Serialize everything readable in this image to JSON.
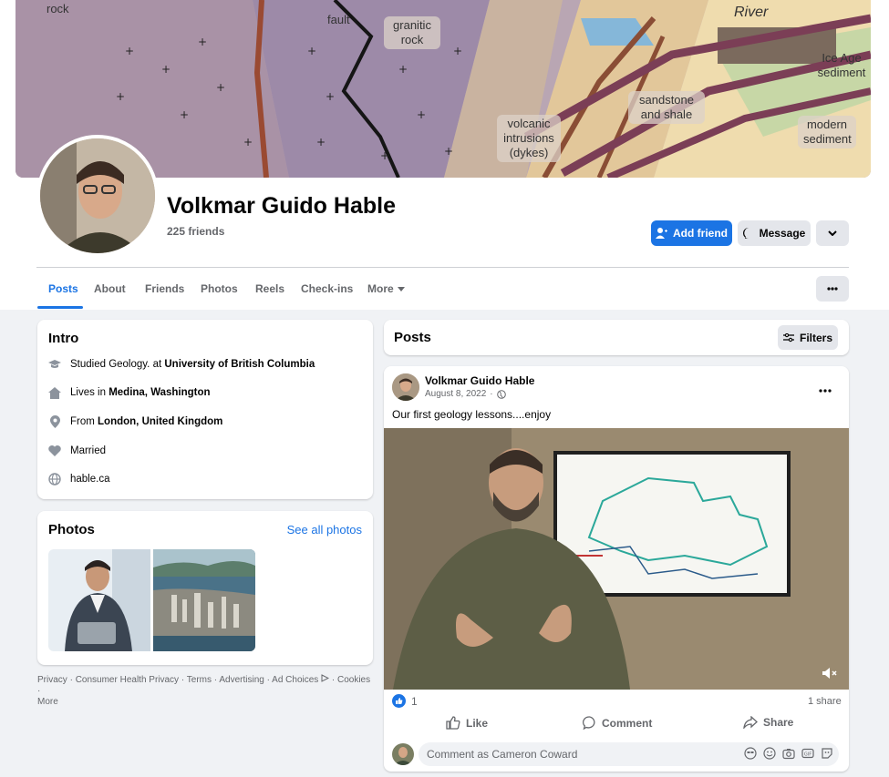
{
  "cover": {
    "labels": {
      "rock": "rock",
      "fault": "fault",
      "granitic": "granitic rock",
      "river": "River",
      "ice_age": "Ice Age sediment",
      "sandstone": "sandstone and shale",
      "volcanic": "volcanic intrusions (dykes)",
      "modern": "modern sediment"
    }
  },
  "profile": {
    "name": "Volkmar Guido Hable",
    "friends": "225 friends"
  },
  "actions": {
    "add_friend": "Add friend",
    "message": "Message"
  },
  "tabs": [
    "Posts",
    "About",
    "Friends",
    "Photos",
    "Reels",
    "Check-ins",
    "More"
  ],
  "intro": {
    "title": "Intro",
    "studied_prefix": "Studied Geology. at ",
    "studied_place": "University of British Columbia",
    "lives_prefix": "Lives in ",
    "lives_place": "Medina, Washington",
    "from_prefix": "From ",
    "from_place": "London, United Kingdom",
    "relationship": "Married",
    "website": "hable.ca"
  },
  "photos": {
    "title": "Photos",
    "see_all": "See all photos"
  },
  "footer": {
    "links": [
      "Privacy",
      "Consumer Health Privacy",
      "Terms",
      "Advertising",
      "Ad Choices",
      "Cookies",
      "More"
    ]
  },
  "posts": {
    "title": "Posts",
    "filters": "Filters",
    "post": {
      "author": "Volkmar Guido Hable",
      "date": "August 8, 2022",
      "text": "Our first geology lessons....enjoy",
      "reactions_count": "1",
      "shares": "1 share"
    },
    "like": "Like",
    "comment": "Comment",
    "share": "Share",
    "comment_placeholder": "Comment as Cameron Coward"
  },
  "icons": {
    "accent": "#1b74e4"
  }
}
